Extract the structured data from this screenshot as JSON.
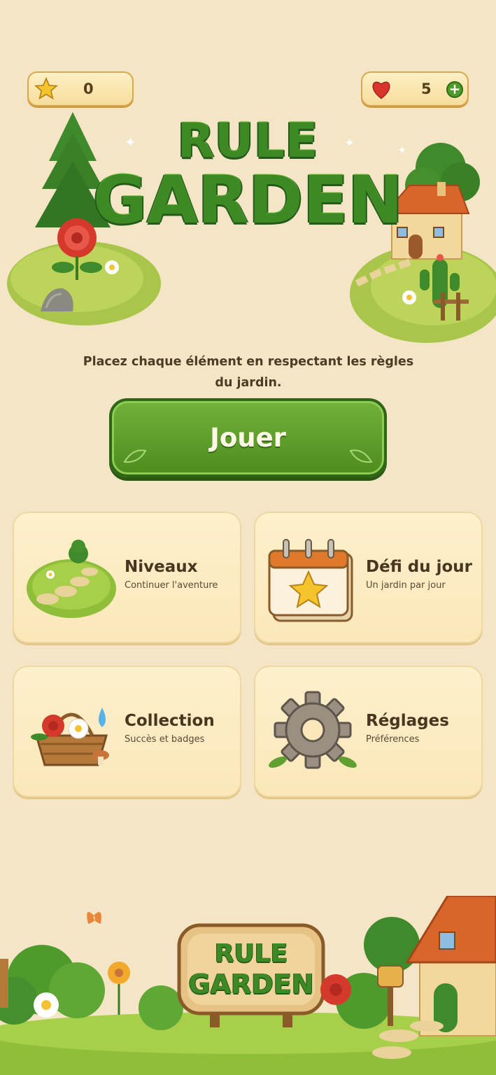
{
  "header": {
    "stars": "0",
    "lives": "5",
    "add_life_label": "+"
  },
  "logo": {
    "line1": "RULE",
    "line2": "GARDEN"
  },
  "subtitle": "Placez chaque élément en respectant les règles du jardin.",
  "play_button": {
    "label": "Jouer"
  },
  "menu": [
    {
      "title": "Niveaux",
      "subtitle": "Continuer l'aventure",
      "icon": "garden-path-icon"
    },
    {
      "title": "Défi du jour",
      "subtitle": "Un jardin par jour",
      "icon": "calendar-star-icon"
    },
    {
      "title": "Collection",
      "subtitle": "Succès et badges",
      "icon": "flower-basket-icon"
    },
    {
      "title": "Réglages",
      "subtitle": "Préférences",
      "icon": "gear-icon"
    }
  ],
  "footer_sign": {
    "line1": "RULE",
    "line2": "GARDEN"
  },
  "colors": {
    "background": "#f5e5c7",
    "accent_green": "#4d8c1e",
    "card": "#fbe7b9",
    "gold": "#f2c230",
    "heart": "#d9342b"
  }
}
